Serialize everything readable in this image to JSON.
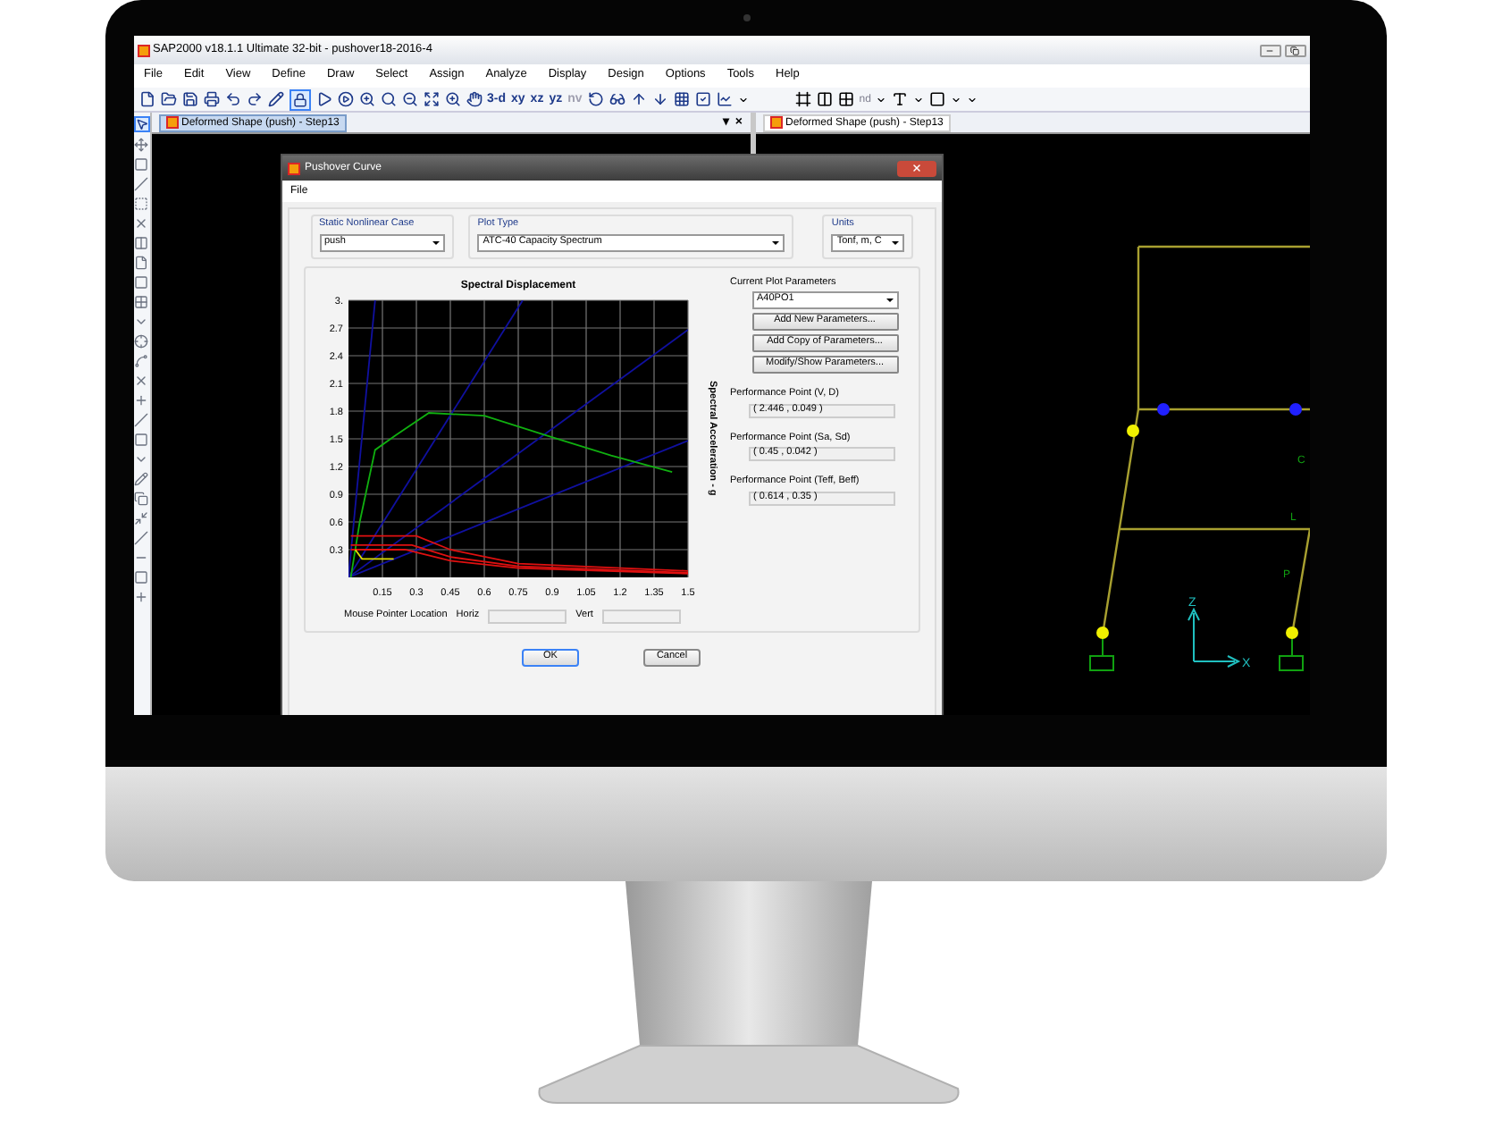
{
  "app_window": {
    "title": "SAP2000 v18.1.1 Ultimate 32-bit - pushover18-2016-4"
  },
  "menu": [
    "File",
    "Edit",
    "View",
    "Define",
    "Draw",
    "Select",
    "Assign",
    "Analyze",
    "Display",
    "Design",
    "Options",
    "Tools",
    "Help"
  ],
  "toolbar": {
    "lock_pressed": true,
    "view_buttons": [
      {
        "label": "3-d",
        "disabled": false
      },
      {
        "label": "xy",
        "disabled": false
      },
      {
        "label": "xz",
        "disabled": false
      },
      {
        "label": "yz",
        "disabled": false
      },
      {
        "label": "nv",
        "disabled": true
      }
    ],
    "frame_label": "nd"
  },
  "side_toolbar": {
    "pointer_pressed": true
  },
  "panes": [
    {
      "tab": {
        "label": "Deformed Shape (push) - Step13",
        "selected": true
      },
      "controls": [
        "▾",
        "×"
      ]
    },
    {
      "tab": {
        "label": "Deformed Shape (push) - Step13",
        "selected": false
      }
    }
  ],
  "frame_view": {
    "axis_labels": [
      "Z",
      "X"
    ],
    "member_labels": [
      "C",
      "L",
      "P"
    ]
  },
  "dialog": {
    "title": "Pushover Curve",
    "menu": [
      "File"
    ],
    "case": {
      "label": "Static Nonlinear Case",
      "value": "push"
    },
    "plot_type": {
      "label": "Plot Type",
      "value": "ATC-40 Capacity Spectrum"
    },
    "units": {
      "label": "Units",
      "value": "Tonf, m, C"
    },
    "chart_data": {
      "type": "line",
      "title": "Spectral Displacement",
      "ylabel": "Spectral Acceleration - g",
      "grid": true,
      "xlim": [
        0,
        1.5
      ],
      "ylim": [
        0,
        3
      ],
      "xticks": [
        0.15,
        0.3,
        0.45,
        0.6,
        0.75,
        0.9,
        1.05,
        1.2,
        1.35,
        1.5
      ],
      "yticks": [
        0.3,
        0.6,
        0.9,
        1.2,
        1.5,
        1.8,
        2.1,
        2.4,
        2.7,
        {
          "value": 3,
          "label": "3."
        }
      ],
      "series": [
        {
          "color": "#1010a0",
          "x": [
            0,
            0.118
          ],
          "values": [
            0,
            3
          ]
        },
        {
          "color": "#1010a0",
          "x": [
            0,
            0.77
          ],
          "values": [
            0,
            3
          ]
        },
        {
          "color": "#1010a0",
          "x": [
            0,
            1.5
          ],
          "values": [
            0,
            2.68
          ]
        },
        {
          "color": "#1010a0",
          "x": [
            0,
            1.5
          ],
          "values": [
            0,
            1.48
          ]
        },
        {
          "color": "#10b010",
          "x": [
            0.01,
            0.05,
            0.118,
            0.21,
            0.355,
            0.6,
            0.87,
            1.16,
            1.43
          ],
          "values": [
            0,
            0.6,
            1.38,
            1.54,
            1.78,
            1.75,
            1.54,
            1.32,
            1.14
          ]
        },
        {
          "color": "#e01010",
          "x": [
            0.01,
            0.3,
            0.45,
            0.75,
            1.5
          ],
          "values": [
            0.45,
            0.45,
            0.3,
            0.15,
            0.07
          ]
        },
        {
          "color": "#e01010",
          "x": [
            0.01,
            0.28,
            0.45,
            0.75,
            1.5
          ],
          "values": [
            0.35,
            0.35,
            0.22,
            0.12,
            0.05
          ]
        },
        {
          "color": "#e01010",
          "x": [
            0.01,
            0.25,
            0.45,
            0.75,
            1.5
          ],
          "values": [
            0.3,
            0.3,
            0.18,
            0.1,
            0.04
          ]
        },
        {
          "color": "#e0e000",
          "x": [
            0.03,
            0.06,
            0.2
          ],
          "values": [
            0.3,
            0.2,
            0.2
          ]
        }
      ]
    },
    "parameters": {
      "label": "Current Plot Parameters",
      "value": "A40PO1",
      "buttons": [
        "Add New Parameters...",
        "Add Copy of Parameters...",
        "Modify/Show Parameters..."
      ]
    },
    "performance_points": [
      {
        "label": "Performance Point (V, D)",
        "value": "( 2.446 , 0.049 )"
      },
      {
        "label": "Performance Point (Sa, Sd)",
        "value": "( 0.45 , 0.042 )"
      },
      {
        "label": "Performance Point (Teff, Beff)",
        "value": "( 0.614 , 0.35 )"
      }
    ],
    "pointer_location": {
      "label": "Mouse Pointer Location",
      "fields": [
        "Horiz",
        "Vert"
      ]
    },
    "buttons": [
      "OK",
      "Cancel"
    ]
  }
}
